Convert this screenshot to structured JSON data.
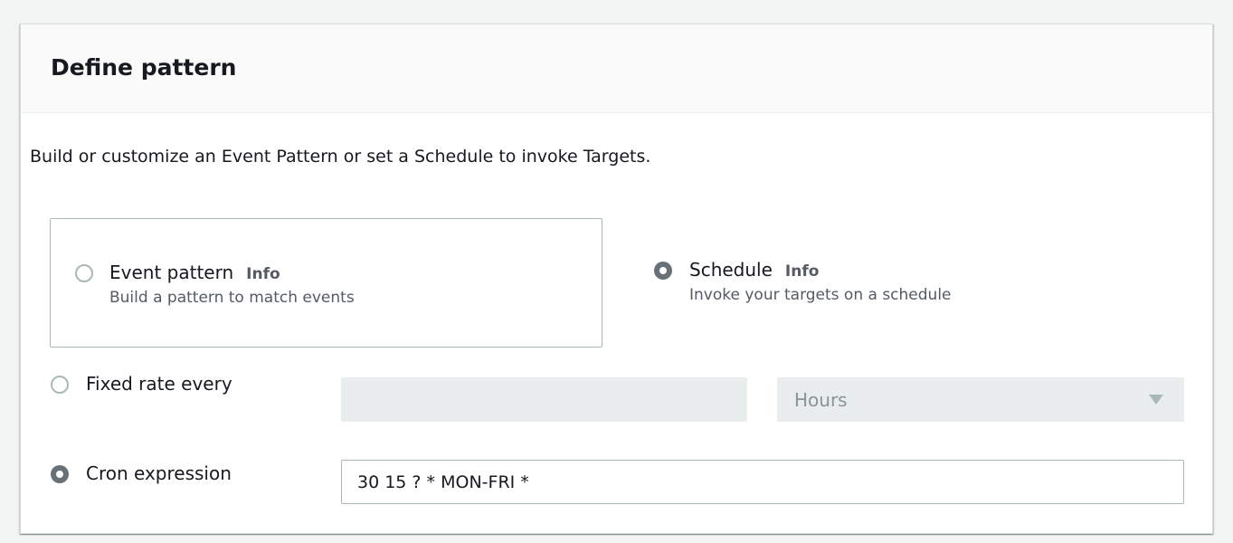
{
  "panel": {
    "title": "Define pattern",
    "description": "Build or customize an Event Pattern or set a Schedule to invoke Targets."
  },
  "options": {
    "event_pattern": {
      "label": "Event pattern",
      "info": "Info",
      "description": "Build a pattern to match events",
      "selected": false
    },
    "schedule": {
      "label": "Schedule",
      "info": "Info",
      "description": "Invoke your targets on a schedule",
      "selected": true
    }
  },
  "schedule": {
    "fixed_rate": {
      "label": "Fixed rate every",
      "value": "",
      "unit": "Hours",
      "selected": false
    },
    "cron": {
      "label": "Cron expression",
      "value": "30 15 ? * MON-FRI *",
      "selected": true
    }
  },
  "colors": {
    "radio_checked": "#687078",
    "radio_border": "#aab7b8",
    "text_secondary": "#545b64",
    "disabled_bg": "#eaeded"
  }
}
